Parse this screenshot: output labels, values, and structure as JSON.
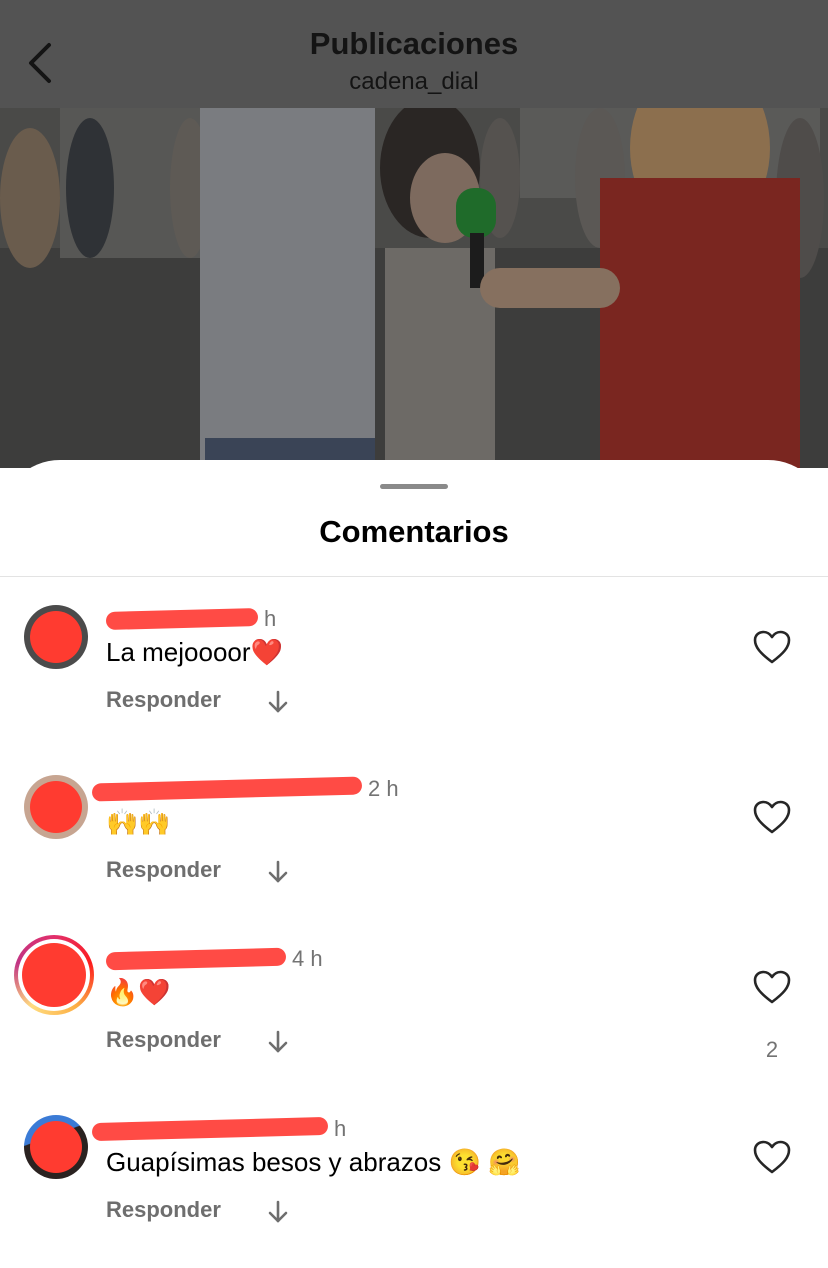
{
  "header": {
    "title": "Publicaciones",
    "subtitle": "cadena_dial",
    "back_icon": "chevron-left-icon"
  },
  "sheet": {
    "title": "Comentarios"
  },
  "comments": [
    {
      "time": "h",
      "text": "La mejoooor❤️",
      "reply_label": "Responder",
      "likes": ""
    },
    {
      "time": "2 h",
      "text": "🙌🙌",
      "reply_label": "Responder",
      "likes": ""
    },
    {
      "time": "4 h",
      "text": "🔥❤️",
      "reply_label": "Responder",
      "likes": "2"
    },
    {
      "time": "h",
      "text": "Guapísimas besos y abrazos 😘 🤗",
      "reply_label": "Responder",
      "likes": ""
    }
  ],
  "colors": {
    "overlay": "#535353",
    "redaction": "#ff3b30",
    "secondary_text": "#737373"
  }
}
